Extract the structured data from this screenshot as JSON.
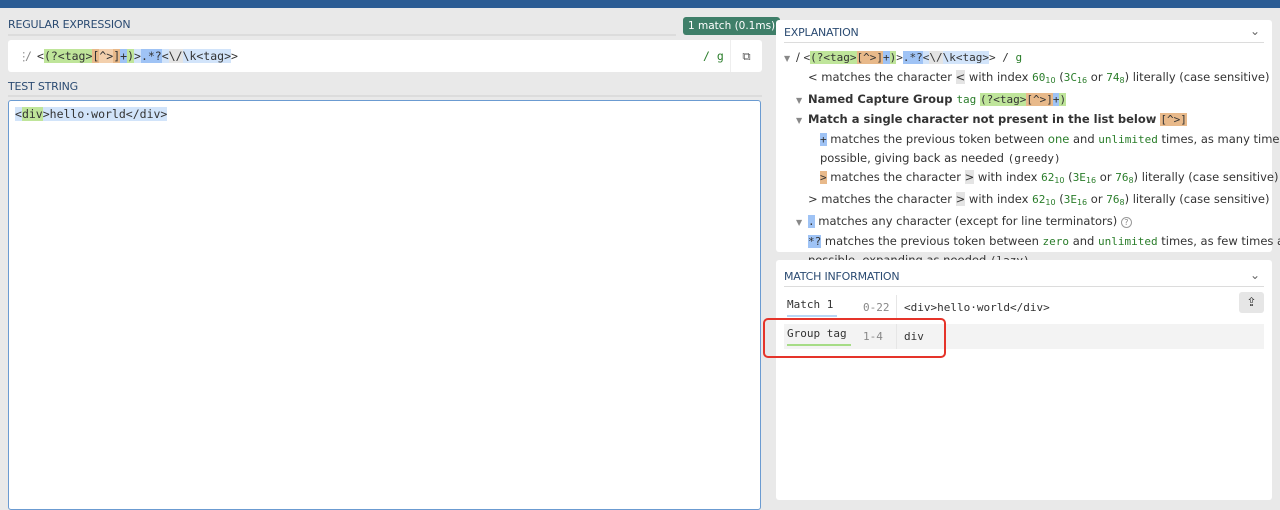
{
  "regex": {
    "title": "REGULAR EXPRESSION",
    "badge": "1 match (0.1ms)",
    "delim": "/",
    "flags": "/ g",
    "segments": [
      {
        "t": "<",
        "c": ""
      },
      {
        "t": "(?<tag>",
        "c": "g"
      },
      {
        "t": "[",
        "c": "o"
      },
      {
        "t": "^>",
        "c": "o2"
      },
      {
        "t": "]",
        "c": "o"
      },
      {
        "t": "+",
        "c": "b"
      },
      {
        "t": ")",
        "c": "g"
      },
      {
        "t": ">",
        "c": "lb"
      },
      {
        "t": ".*?",
        "c": "b"
      },
      {
        "t": "<",
        "c": "lb"
      },
      {
        "t": "\\/",
        "c": "gr"
      },
      {
        "t": "\\k<tag>",
        "c": "lb"
      },
      {
        "t": ">",
        "c": ""
      }
    ]
  },
  "test": {
    "title": "TEST STRING",
    "segments": [
      {
        "t": "<",
        "c": "lb"
      },
      {
        "t": "div",
        "c": "g"
      },
      {
        "t": ">hello·world</div>",
        "c": "lb"
      }
    ]
  },
  "explanation": {
    "title": "EXPLANATION",
    "lines": [
      {
        "i": 0,
        "tri": true,
        "s": [
          {
            "t": "/ ",
            "c": ""
          },
          {
            "t": "<",
            "c": "c"
          },
          {
            "t": "(?<tag>",
            "c": "c g"
          },
          {
            "t": "[^>]",
            "c": "c o"
          },
          {
            "t": "+",
            "c": "c b"
          },
          {
            "t": ")",
            "c": "c g"
          },
          {
            "t": ">",
            "c": "c"
          },
          {
            "t": ".*?",
            "c": "c b"
          },
          {
            "t": "<",
            "c": "c lb"
          },
          {
            "t": "\\/",
            "c": "c gr"
          },
          {
            "t": "\\k<tag>",
            "c": "c lb"
          },
          {
            "t": "> / ",
            "c": "c"
          },
          {
            "t": "g",
            "c": "c gt"
          }
        ]
      },
      {
        "i": 1,
        "s": [
          {
            "t": "< matches the character ",
            "c": ""
          },
          {
            "t": "<",
            "c": "gr"
          },
          {
            "t": " with index ",
            "c": ""
          },
          {
            "t": "60",
            "c": "c gt"
          },
          {
            "t": "10",
            "c": "sub gt"
          },
          {
            "t": " (",
            "c": ""
          },
          {
            "t": "3C",
            "c": "c gt"
          },
          {
            "t": "16",
            "c": "sub gt"
          },
          {
            "t": " or ",
            "c": ""
          },
          {
            "t": "74",
            "c": "c gt"
          },
          {
            "t": "8",
            "c": "sub gt"
          },
          {
            "t": ") literally (case sensitive)",
            "c": ""
          }
        ]
      },
      {
        "i": 1,
        "tri": true,
        "s": [
          {
            "t": "Named Capture Group ",
            "c": "bold"
          },
          {
            "t": "tag",
            "c": "c gt"
          },
          {
            "t": " ",
            "c": ""
          },
          {
            "t": "(?<tag>",
            "c": "c g"
          },
          {
            "t": "[^>]",
            "c": "c o"
          },
          {
            "t": "+",
            "c": "c b"
          },
          {
            "t": ")",
            "c": "c g"
          }
        ]
      },
      {
        "i": 2,
        "tri": true,
        "s": [
          {
            "t": "Match a single character not present in the list below ",
            "c": "bold"
          },
          {
            "t": "[^>]",
            "c": "c o"
          }
        ]
      },
      {
        "i": 3,
        "s": [
          {
            "t": "+",
            "c": "c b"
          },
          {
            "t": " matches the previous token between ",
            "c": ""
          },
          {
            "t": "one",
            "c": "gt"
          },
          {
            "t": " and ",
            "c": ""
          },
          {
            "t": "unlimited",
            "c": "c gt"
          },
          {
            "t": " times, as many times as",
            "c": ""
          }
        ]
      },
      {
        "i": 3,
        "s": [
          {
            "t": "possible, giving back as needed ",
            "c": ""
          },
          {
            "t": "(greedy)",
            "c": "c"
          }
        ]
      },
      {
        "i": 3,
        "s": [
          {
            "t": ">",
            "c": "c o"
          },
          {
            "t": " matches the character ",
            "c": ""
          },
          {
            "t": ">",
            "c": "gr"
          },
          {
            "t": " with index ",
            "c": ""
          },
          {
            "t": "62",
            "c": "c gt"
          },
          {
            "t": "10",
            "c": "sub gt"
          },
          {
            "t": " (",
            "c": ""
          },
          {
            "t": "3E",
            "c": "c gt"
          },
          {
            "t": "16",
            "c": "sub gt"
          },
          {
            "t": " or ",
            "c": ""
          },
          {
            "t": "76",
            "c": "c gt"
          },
          {
            "t": "8",
            "c": "sub gt"
          },
          {
            "t": ") literally (case sensitive)",
            "c": ""
          }
        ]
      },
      {
        "i": 1,
        "s": [
          {
            "t": "> matches the character ",
            "c": ""
          },
          {
            "t": ">",
            "c": "gr"
          },
          {
            "t": " with index ",
            "c": ""
          },
          {
            "t": "62",
            "c": "c gt"
          },
          {
            "t": "10",
            "c": "sub gt"
          },
          {
            "t": " (",
            "c": ""
          },
          {
            "t": "3E",
            "c": "c gt"
          },
          {
            "t": "16",
            "c": "sub gt"
          },
          {
            "t": " or ",
            "c": ""
          },
          {
            "t": "76",
            "c": "c gt"
          },
          {
            "t": "8",
            "c": "sub gt"
          },
          {
            "t": ") literally (case sensitive)",
            "c": ""
          }
        ]
      },
      {
        "i": 1,
        "tri": true,
        "s": [
          {
            "t": ".",
            "c": "c b"
          },
          {
            "t": " matches any character (except for line terminators) ",
            "c": ""
          },
          {
            "t": "?",
            "c": "help"
          }
        ]
      },
      {
        "i": 2,
        "s": [
          {
            "t": "*?",
            "c": "c b"
          },
          {
            "t": " matches the previous token between ",
            "c": ""
          },
          {
            "t": "zero",
            "c": "c gt"
          },
          {
            "t": " and ",
            "c": ""
          },
          {
            "t": "unlimited",
            "c": "c gt"
          },
          {
            "t": " times, as few times as",
            "c": ""
          }
        ]
      },
      {
        "i": 2,
        "s": [
          {
            "t": "possible, expanding as needed ",
            "c": ""
          },
          {
            "t": "(lazy)",
            "c": "c"
          }
        ]
      }
    ]
  },
  "match": {
    "title": "MATCH INFORMATION",
    "rows": [
      {
        "label": "Match 1",
        "range": "0-22",
        "value": "<div>hello·world</div>",
        "underline": "#b9d6f5"
      },
      {
        "label": "Group tag",
        "range": "1-4",
        "value": "div",
        "underline": "#a6dc86"
      }
    ]
  },
  "colors": {
    "accent": "#2b5c94",
    "badge": "#3f7f69",
    "highlight": "#e5342a"
  }
}
